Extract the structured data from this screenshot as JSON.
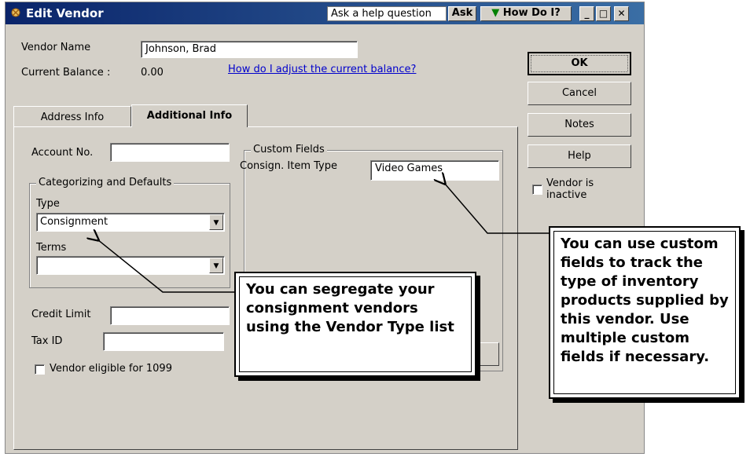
{
  "window": {
    "title": "Edit Vendor",
    "help_placeholder": "Ask a help question",
    "ask_label": "Ask",
    "how_do_i_label": "How Do I?",
    "min_label": "_",
    "max_label": "□",
    "close_label": "✕"
  },
  "vendor": {
    "name_label": "Vendor Name",
    "name_value": "Johnson, Brad",
    "balance_label": "Current Balance :",
    "balance_value": "0.00",
    "balance_link": "How do I adjust the current balance?"
  },
  "tabs": [
    {
      "label": "Address Info"
    },
    {
      "label": "Additional Info"
    }
  ],
  "additional": {
    "account_label": "Account No.",
    "account_value": "",
    "categorizing_title": "Categorizing and Defaults",
    "type_label": "Type",
    "type_value": "Consignment",
    "terms_label": "Terms",
    "terms_value": "",
    "credit_label": "Credit Limit",
    "credit_value": "",
    "taxid_label": "Tax ID",
    "taxid_value": "",
    "eligible_1099_label": "Vendor eligible for 1099",
    "custom_title": "Custom Fields",
    "custom_field_label": "Consign. Item Type",
    "custom_field_value": "Video Games"
  },
  "buttons": {
    "ok": "OK",
    "cancel": "Cancel",
    "notes": "Notes",
    "help": "Help",
    "inactive_label": "Vendor is inactive"
  },
  "callouts": {
    "custom_fields": "You can use custom fields to track the type of inventory products supplied by this vendor. Use multiple custom fields if necessary.",
    "vendor_type": "You can segregate your consignment vendors using the Vendor Type list"
  },
  "colors": {
    "titlebar": "#0a246a",
    "dialog_bg": "#d4d0c8",
    "link": "#0000cc"
  }
}
